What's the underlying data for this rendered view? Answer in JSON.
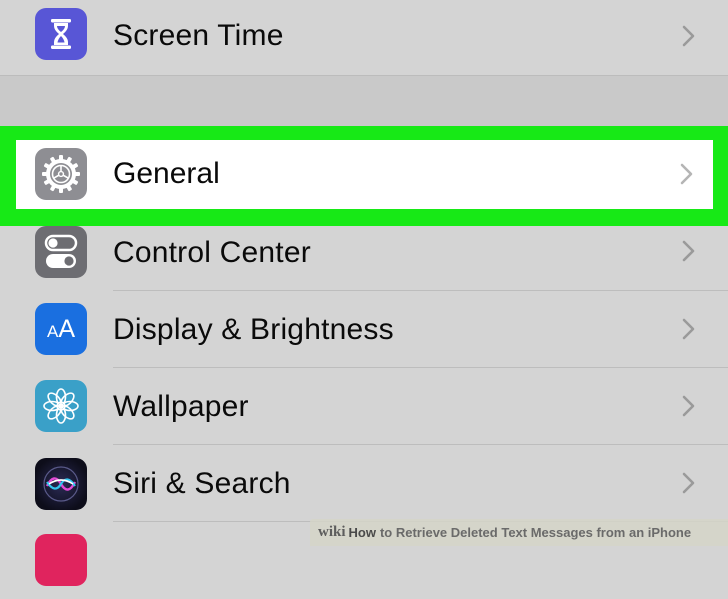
{
  "settings": {
    "items": [
      {
        "label": "Screen Time",
        "icon": "hourglass-icon",
        "color": "#5856d6"
      },
      {
        "label": "General",
        "icon": "gear-icon",
        "color": "#8e8e93",
        "highlighted": true
      },
      {
        "label": "Control Center",
        "icon": "toggle-switches-icon",
        "color": "#6d6d72"
      },
      {
        "label": "Display & Brightness",
        "icon": "text-size-icon",
        "color": "#1a6fe0"
      },
      {
        "label": "Wallpaper",
        "icon": "flower-icon",
        "color": "#3aa0c8"
      },
      {
        "label": "Siri & Search",
        "icon": "siri-icon",
        "color": "#1a1a2e"
      }
    ],
    "highlight_color": "#17e916"
  },
  "watermark": {
    "brand": "wiki",
    "how": "How",
    "title": "to Retrieve Deleted Text Messages from an iPhone"
  }
}
